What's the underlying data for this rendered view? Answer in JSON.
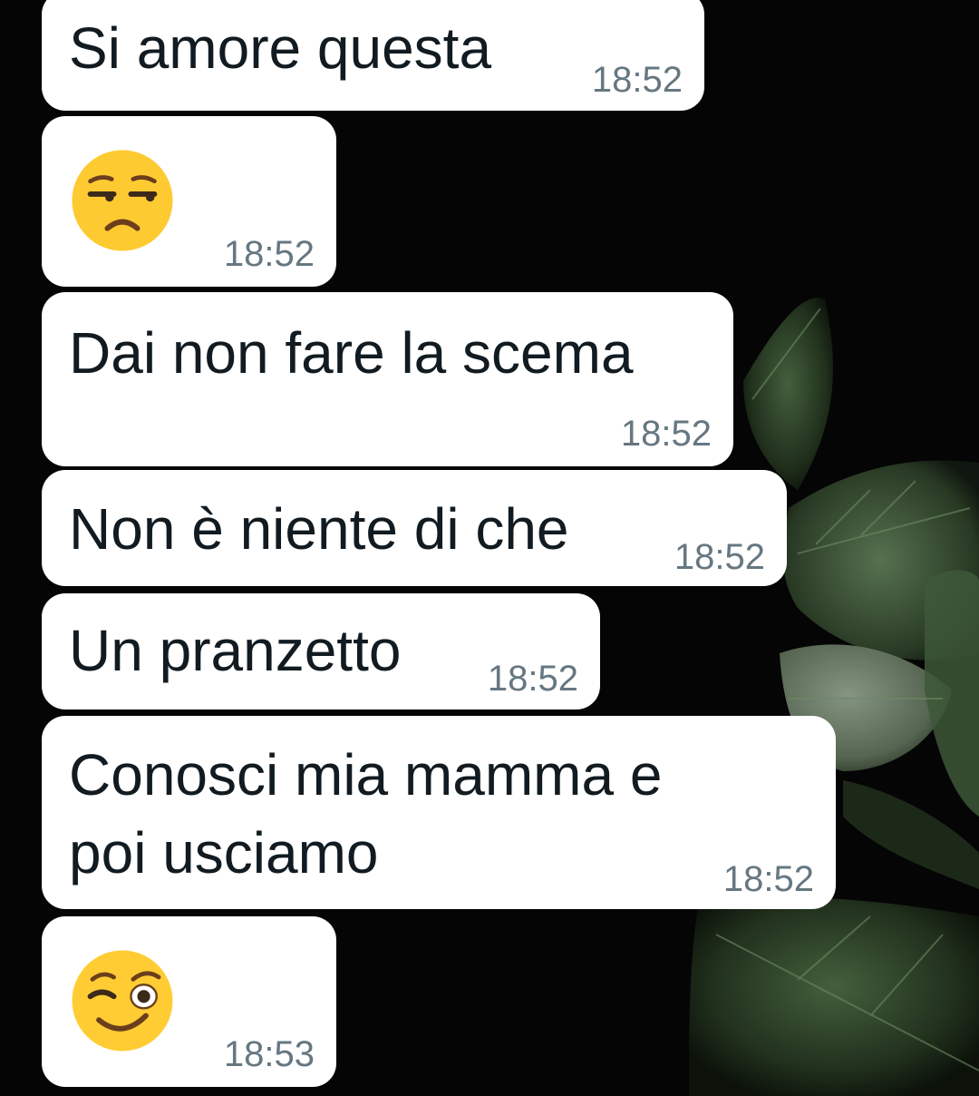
{
  "messages": [
    {
      "text": "Si amore questa",
      "time": "18:52"
    },
    {
      "emoji": "unamused-face-emoji",
      "time": "18:52"
    },
    {
      "text": "Dai non fare la scema",
      "time": "18:52"
    },
    {
      "text": "Non è niente di che",
      "time": "18:52"
    },
    {
      "text": "Un pranzetto",
      "time": "18:52"
    },
    {
      "text_line1": "Conosci mia mamma e",
      "text_line2": "poi usciamo",
      "time": "18:52"
    },
    {
      "emoji": "winking-face-emoji",
      "time": "18:53"
    }
  ],
  "colors": {
    "bubble": "#ffffff",
    "text": "#111b21",
    "time": "#667781",
    "background": "#050505",
    "leaf": "#2f4529"
  }
}
